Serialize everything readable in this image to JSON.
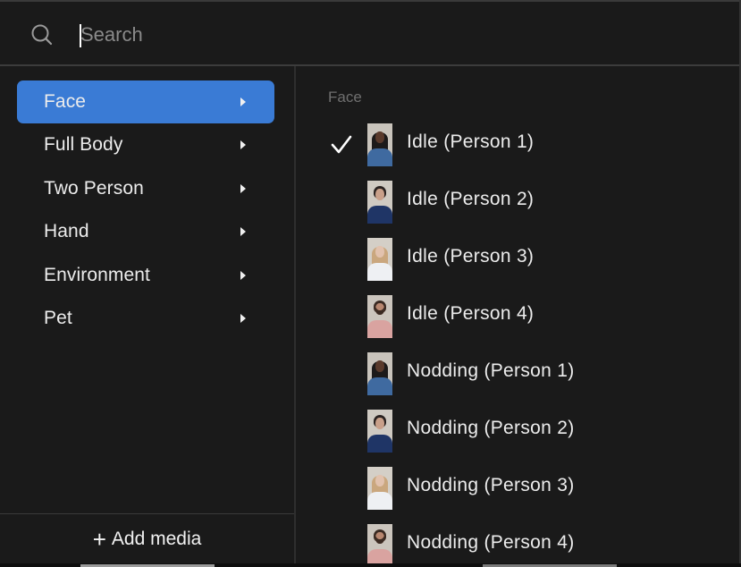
{
  "search": {
    "placeholder": "Search",
    "value": ""
  },
  "categories": [
    {
      "label": "Face",
      "active": true
    },
    {
      "label": "Full Body",
      "active": false
    },
    {
      "label": "Two Person",
      "active": false
    },
    {
      "label": "Hand",
      "active": false
    },
    {
      "label": "Environment",
      "active": false
    },
    {
      "label": "Pet",
      "active": false
    }
  ],
  "add_media": {
    "icon": "+",
    "label": "Add media"
  },
  "section": {
    "title": "Face"
  },
  "media_items": [
    {
      "label": "Idle (Person 1)",
      "selected": true,
      "person": 1
    },
    {
      "label": "Idle (Person 2)",
      "selected": false,
      "person": 2
    },
    {
      "label": "Idle (Person 3)",
      "selected": false,
      "person": 3
    },
    {
      "label": "Idle (Person 4)",
      "selected": false,
      "person": 4
    },
    {
      "label": "Nodding (Person 1)",
      "selected": false,
      "person": 1
    },
    {
      "label": "Nodding (Person 2)",
      "selected": false,
      "person": 2
    },
    {
      "label": "Nodding (Person 3)",
      "selected": false,
      "person": 3
    },
    {
      "label": "Nodding (Person 4)",
      "selected": false,
      "person": 4
    }
  ],
  "colors": {
    "accent": "#3a7bd5",
    "background": "#1a1a1a",
    "section_label": "#6f6f6f"
  }
}
